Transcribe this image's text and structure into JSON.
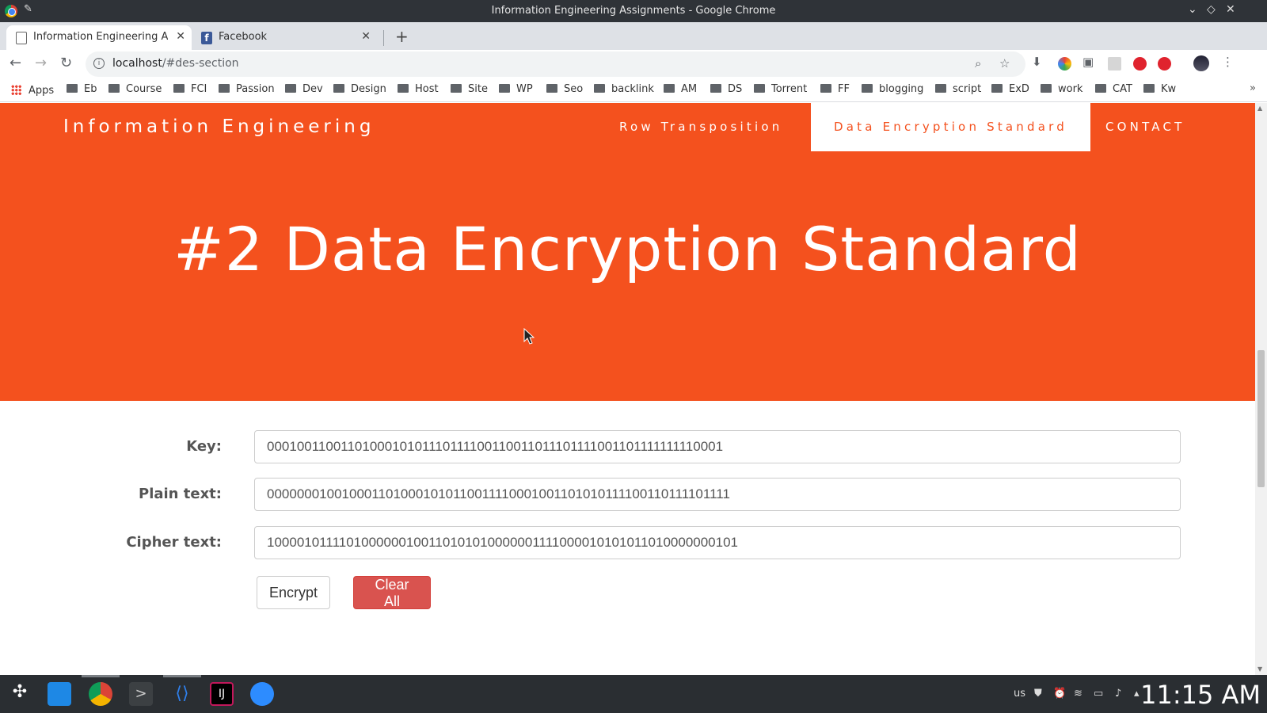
{
  "window": {
    "title": "Information Engineering Assignments - Google Chrome"
  },
  "tabs": [
    {
      "label": "Information Engineering Assi"
    },
    {
      "label": "Facebook"
    }
  ],
  "address_bar": {
    "host": "localhost",
    "path": "/#des-section"
  },
  "bookmarks": [
    "Apps",
    "Eb",
    "Course",
    "FCI",
    "Passion",
    "Dev",
    "Design",
    "Host",
    "Site",
    "WP",
    "Seo",
    "backlink",
    "AM",
    "DS",
    "Torrent",
    "FF",
    "blogging",
    "script",
    "ExD",
    "work",
    "CAT",
    "Kw"
  ],
  "site": {
    "brand": "Information Engineering",
    "nav": [
      {
        "label": "Row Transposition"
      },
      {
        "label": "Data Encryption Standard"
      },
      {
        "label": "CONTACT"
      }
    ],
    "hero_title": "#2 Data Encryption Standard"
  },
  "form": {
    "key_label": "Key:",
    "key_value": "0001001100110100010101110111100110011011101111001101111111110001",
    "plain_label": "Plain text:",
    "plain_value": "0000000100100011010001010110011110001001101010111100110111101111",
    "cipher_label": "Cipher text:",
    "cipher_value": "1000010111101000000100110101010000001111000010101011010000000101",
    "encrypt_label": "Encrypt",
    "clear_label": "Clear All"
  },
  "taskbar": {
    "keyboard_layout": "us",
    "clock": "11:15 AM"
  },
  "colors": {
    "hero": "#f4511e",
    "danger": "#d9534f"
  }
}
